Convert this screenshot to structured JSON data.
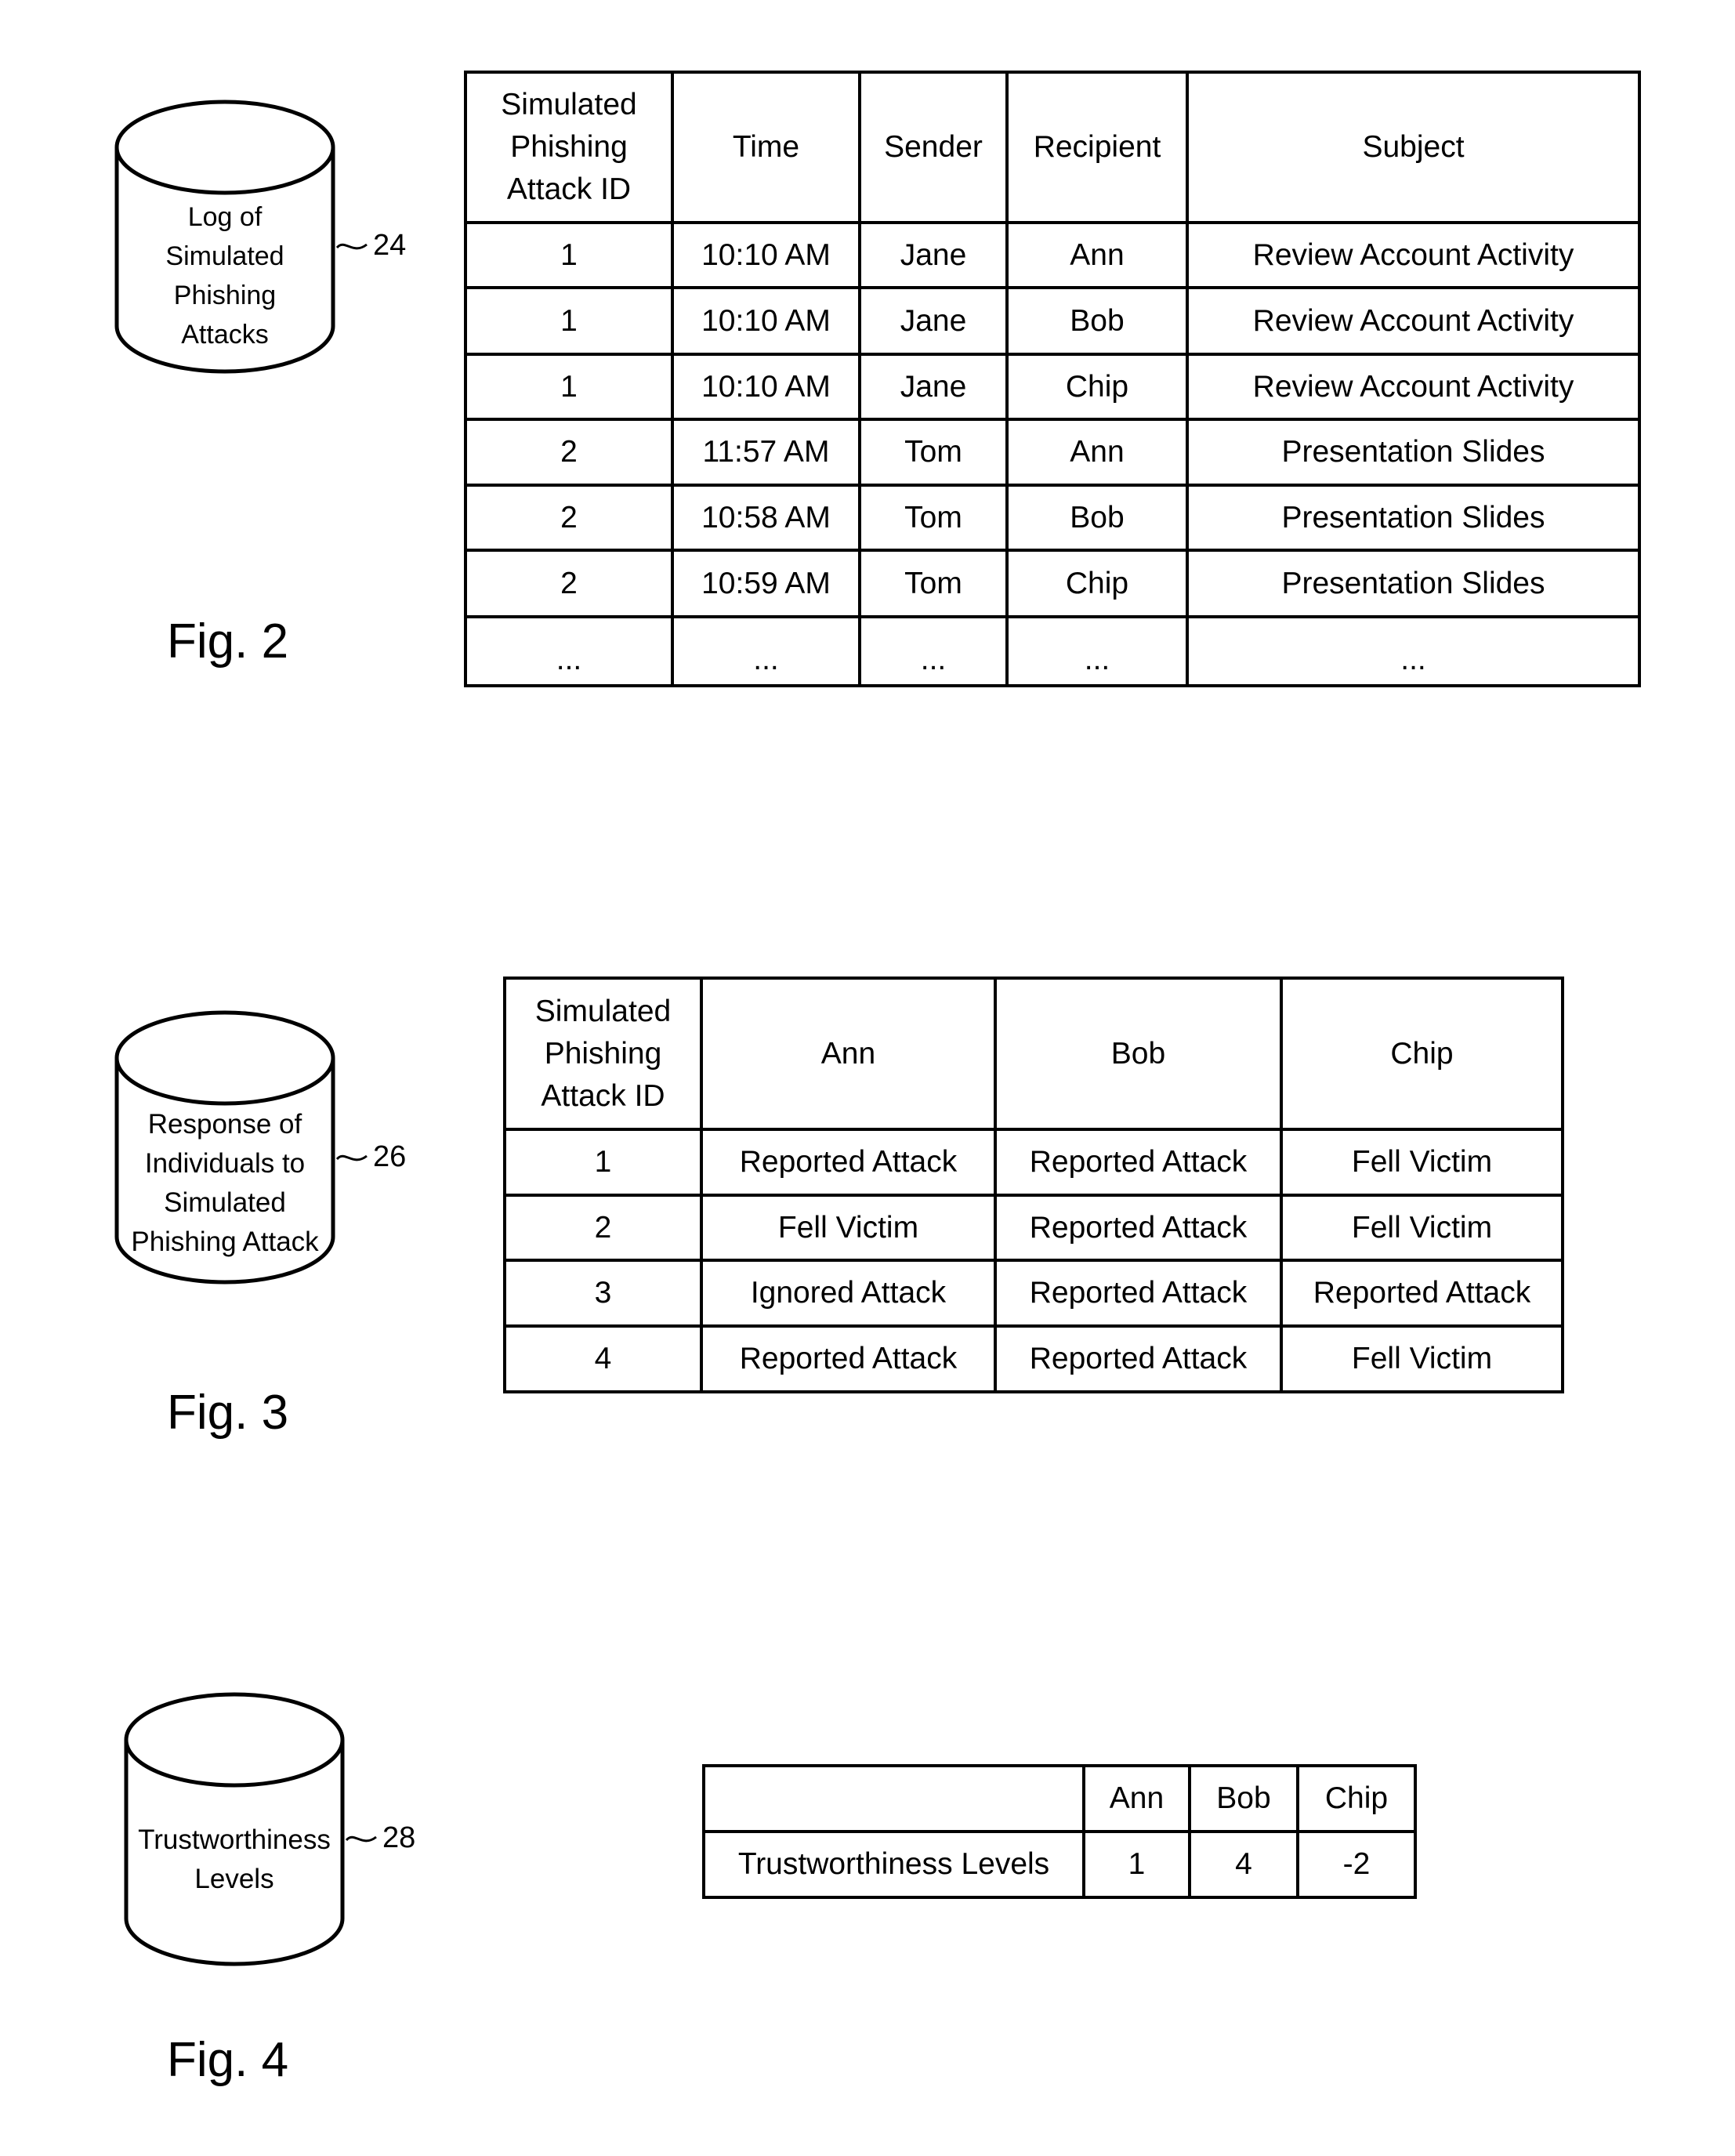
{
  "fig2": {
    "label": "Fig. 2",
    "database": {
      "lines": [
        "Log of",
        "Simulated",
        "Phishing",
        "Attacks"
      ],
      "ref": "24"
    },
    "table": {
      "headers": [
        [
          "Simulated",
          "Phishing",
          "Attack ID"
        ],
        [
          "Time"
        ],
        [
          "Sender"
        ],
        [
          "Recipient"
        ],
        [
          "Subject"
        ]
      ],
      "rows": [
        [
          "1",
          "10:10 AM",
          "Jane",
          "Ann",
          "Review Account Activity"
        ],
        [
          "1",
          "10:10 AM",
          "Jane",
          "Bob",
          "Review Account Activity"
        ],
        [
          "1",
          "10:10 AM",
          "Jane",
          "Chip",
          "Review Account Activity"
        ],
        [
          "2",
          "11:57 AM",
          "Tom",
          "Ann",
          "Presentation Slides"
        ],
        [
          "2",
          "10:58 AM",
          "Tom",
          "Bob",
          "Presentation Slides"
        ],
        [
          "2",
          "10:59 AM",
          "Tom",
          "Chip",
          "Presentation Slides"
        ],
        [
          "...",
          "...",
          "...",
          "...",
          "..."
        ]
      ]
    }
  },
  "fig3": {
    "label": "Fig. 3",
    "database": {
      "lines": [
        "Response of",
        "Individuals to",
        "Simulated",
        "Phishing Attack"
      ],
      "ref": "26"
    },
    "table": {
      "headers": [
        [
          "Simulated",
          "Phishing",
          "Attack ID"
        ],
        [
          "Ann"
        ],
        [
          "Bob"
        ],
        [
          "Chip"
        ]
      ],
      "rows": [
        [
          "1",
          "Reported Attack",
          "Reported Attack",
          "Fell Victim"
        ],
        [
          "2",
          "Fell Victim",
          "Reported Attack",
          "Fell Victim"
        ],
        [
          "3",
          "Ignored Attack",
          "Reported Attack",
          "Reported Attack"
        ],
        [
          "4",
          "Reported Attack",
          "Reported Attack",
          "Fell Victim"
        ]
      ]
    }
  },
  "fig4": {
    "label": "Fig. 4",
    "database": {
      "lines": [
        "Trustworthiness",
        "Levels"
      ],
      "ref": "28"
    },
    "table": {
      "headers": [
        "",
        "Ann",
        "Bob",
        "Chip"
      ],
      "rows": [
        [
          "Trustworthiness Levels",
          "1",
          "4",
          "-2"
        ]
      ]
    }
  }
}
